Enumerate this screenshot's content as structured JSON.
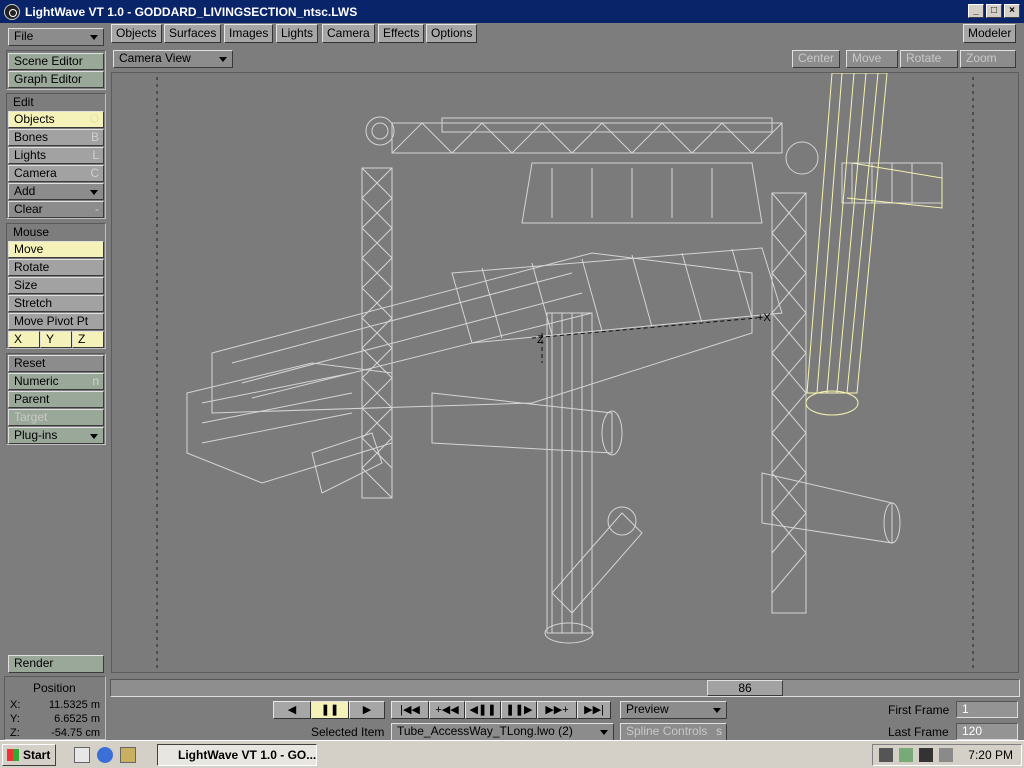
{
  "window": {
    "title": "LightWave VT 1.0 - GODDARD_LIVINGSECTION_ntsc.LWS",
    "min": "_",
    "max": "□",
    "close": "×"
  },
  "left": {
    "file": "File",
    "scene_editor": "Scene Editor",
    "graph_editor": "Graph Editor",
    "edit_header": "Edit",
    "objects": "Objects",
    "objects_sc": "O",
    "bones": "Bones",
    "bones_sc": "B",
    "lights": "Lights",
    "lights_sc": "L",
    "camera": "Camera",
    "camera_sc": "C",
    "add": "Add",
    "clear": "Clear",
    "clear_sc": "-",
    "mouse_header": "Mouse",
    "move": "Move",
    "rotate": "Rotate",
    "size": "Size",
    "stretch": "Stretch",
    "move_pivot": "Move Pivot Pt",
    "x": "X",
    "y": "Y",
    "z": "Z",
    "reset": "Reset",
    "numeric": "Numeric",
    "numeric_sc": "n",
    "parent": "Parent",
    "target": "Target",
    "plugins": "Plug-ins",
    "render": "Render"
  },
  "top_tabs": [
    "Objects",
    "Surfaces",
    "Images",
    "Lights",
    "Camera",
    "Effects",
    "Options"
  ],
  "modeler": "Modeler",
  "view": {
    "select": "Camera View",
    "center": "Center",
    "move": "Move",
    "rotate": "Rotate",
    "zoom": "Zoom"
  },
  "position": {
    "title": "Position",
    "x_label": "X:",
    "x": "11.5325 m",
    "y_label": "Y:",
    "y": "6.6525 m",
    "z_label": "Z:",
    "z": "-54.75 cm"
  },
  "timeline": {
    "frame": "86"
  },
  "transport": {
    "prev": "◀",
    "pause": "❚❚",
    "play": "▶",
    "first": "|◀◀",
    "prev_key": "+◀◀",
    "step_back": "◀❚❚",
    "step_fwd": "❚❚▶",
    "next_key": "▶▶+",
    "last": "▶▶|"
  },
  "preview": "Preview",
  "spline": "Spline Controls",
  "spline_sc": "s",
  "selected_item_label": "Selected Item",
  "selected_item": "Tube_AccessWay_TLong.lwo (2)",
  "first_frame_label": "First Frame",
  "first_frame": "1",
  "last_frame_label": "Last Frame",
  "last_frame": "120",
  "axes": {
    "x": "+X",
    "z": "Z"
  },
  "taskbar": {
    "start": "Start",
    "task": "LightWave VT 1.0 - GO...",
    "time": "7:20 PM"
  },
  "colors": {
    "selected_wire": "#ffffb0",
    "wire": "#d8d8d8",
    "title": "#0a246a"
  }
}
